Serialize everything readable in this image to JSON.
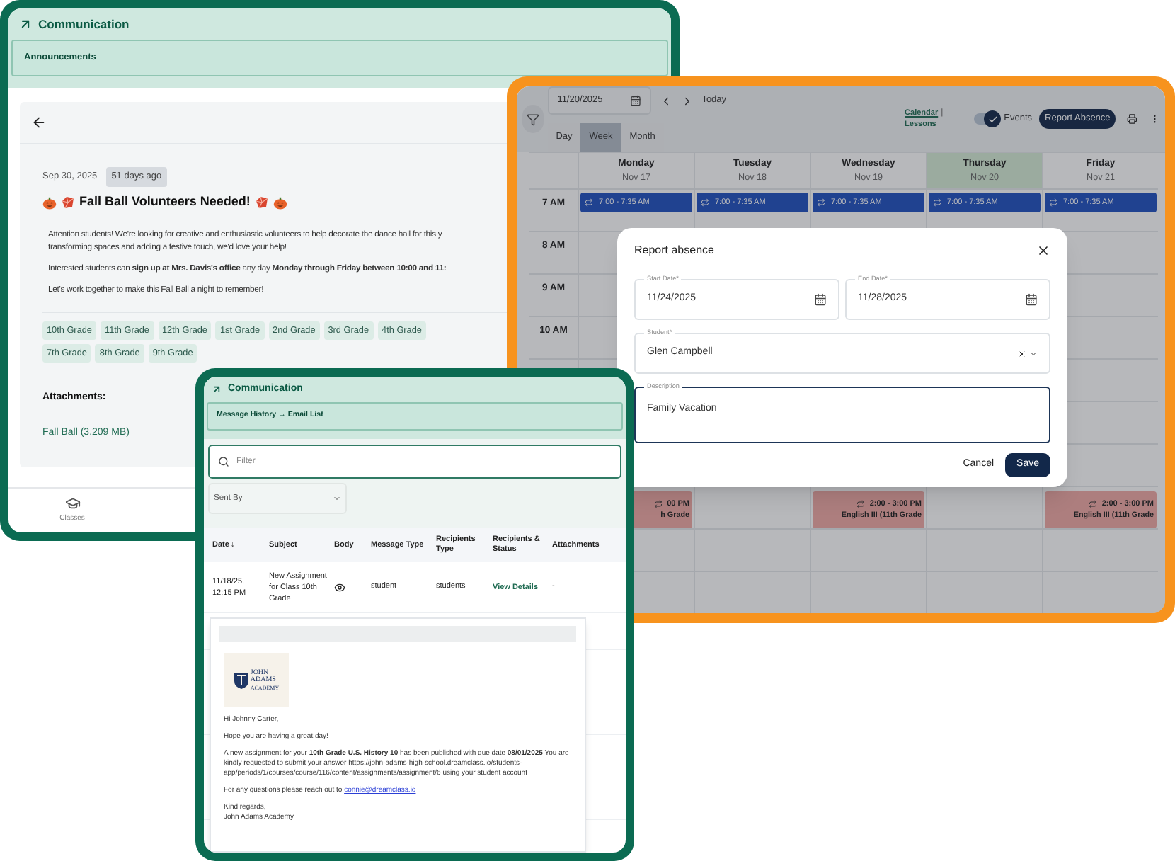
{
  "announcement_window": {
    "header_title": "Communication",
    "tab": "Announcements",
    "date": "Sep 30, 2025",
    "age_badge": "51 days ago",
    "title": "Fall Ball Volunteers Needed!",
    "paragraphs": [
      {
        "lines": [
          "Attention students! We're looking for creative and enthusiastic volunteers to help decorate the dance hall for this y",
          "transforming spaces and adding a festive touch, we'd love your help!"
        ]
      },
      {
        "lines": [
          "Interested students can **sign up at Mrs. Davis's office** any day **Monday through Friday between 10:00 and 11:**"
        ]
      },
      {
        "lines": [
          "Let's work together to make this Fall Ball a night to remember!"
        ]
      }
    ],
    "grade_tag_rows": [
      [
        "10th Grade",
        "11th Grade",
        "12th Grade",
        "1st Grade",
        "2nd Grade",
        "3rd Grade",
        "4th Grade"
      ],
      [
        "7th Grade",
        "8th Grade",
        "9th Grade"
      ]
    ],
    "attachments_label": "Attachments:",
    "attachments": [
      "Fall Ball (3.209 MB)"
    ],
    "bottom_nav": [
      {
        "label": "Classes"
      }
    ]
  },
  "calendar_window": {
    "date": "11/20/2025",
    "today_button": "Today",
    "views": [
      {
        "label": "Day",
        "selected": false
      },
      {
        "label": "Week",
        "selected": true
      },
      {
        "label": "Month",
        "selected": false
      }
    ],
    "links": [
      {
        "label": "Calendar",
        "selected": true
      },
      {
        "label": "Lessons",
        "selected": false
      }
    ],
    "link_separator": "|",
    "events_toggle": {
      "label": "Events",
      "on": true
    },
    "report_button": "Report Absence",
    "hours": [
      "7 AM",
      "8 AM",
      "9 AM",
      "10 AM"
    ],
    "days": [
      {
        "name": "Monday",
        "date": "Nov 17",
        "today": false,
        "events": [
          {
            "kind": "recurring",
            "time": "7:00 - 7:35 AM"
          },
          {
            "kind": "lesson",
            "time": "00 PM",
            "title": "h Grade"
          }
        ]
      },
      {
        "name": "Tuesday",
        "date": "Nov 18",
        "today": false,
        "events": [
          {
            "kind": "recurring",
            "time": "7:00 - 7:35 AM"
          }
        ]
      },
      {
        "name": "Wednesday",
        "date": "Nov 19",
        "today": false,
        "events": [
          {
            "kind": "recurring",
            "time": "7:00 - 7:35 AM"
          },
          {
            "kind": "lesson",
            "time": "2:00 - 3:00 PM",
            "title": "English III (11th Grade"
          }
        ]
      },
      {
        "name": "Thursday",
        "date": "Nov 20",
        "today": true,
        "events": [
          {
            "kind": "recurring",
            "time": "7:00 - 7:35 AM"
          }
        ]
      },
      {
        "name": "Friday",
        "date": "Nov 21",
        "today": false,
        "events": [
          {
            "kind": "recurring",
            "time": "7:00 - 7:35 AM"
          },
          {
            "kind": "lesson",
            "time": "2:00 - 3:00 PM",
            "title": "English III (11th Grade"
          }
        ]
      }
    ]
  },
  "absence_dialog": {
    "title": "Report absence",
    "start_date": {
      "label": "Start Date*",
      "value": "11/24/2025"
    },
    "end_date": {
      "label": "End Date*",
      "value": "11/28/2025"
    },
    "student": {
      "label": "Student*",
      "value": "Glen Campbell"
    },
    "description": {
      "label": "Description",
      "value": "Family Vacation",
      "focused": true
    },
    "cancel_button": "Cancel",
    "save_button": "Save"
  },
  "email_window": {
    "header_title": "Communication",
    "breadcrumb": "Message History → Email List",
    "filter_placeholder": "Filter",
    "sent_by": "Sent By",
    "columns": [
      {
        "label": "Date",
        "sort_mark": "↓"
      },
      {
        "label": "Subject"
      },
      {
        "label": "Body"
      },
      {
        "label": "Message Type"
      },
      {
        "label": "Recipients Type"
      },
      {
        "label": "Recipients & Status"
      },
      {
        "label": "Attachments"
      }
    ],
    "rows": [
      {
        "date": "11/18/25, 12:15 PM",
        "subject": "New Assignment for Class 10th Grade",
        "message_type": "student",
        "recipients_type": "students",
        "status_link": "View Details",
        "attachments": "-"
      }
    ],
    "preview": {
      "logo_lines": [
        "JOHN",
        "ADAMS",
        "ACADEMY"
      ],
      "greeting": "Hi Johnny Carter,",
      "opening": "Hope you are having a great day!",
      "body": "A new assignment for your **10th Grade U.S. History 10** has been published with due date **08/01/2025** You are kindly requested to submit your answer https://john-adams-high-school.dreamclass.io/students-app/periods/1/courses/course/116/content/assignments/assignment/6 using your student account",
      "contact_text": "For any questions please reach out to",
      "contact_link": "connie@dreamclass.io",
      "closing": [
        "Kind regards,",
        "John Adams Academy"
      ]
    }
  }
}
